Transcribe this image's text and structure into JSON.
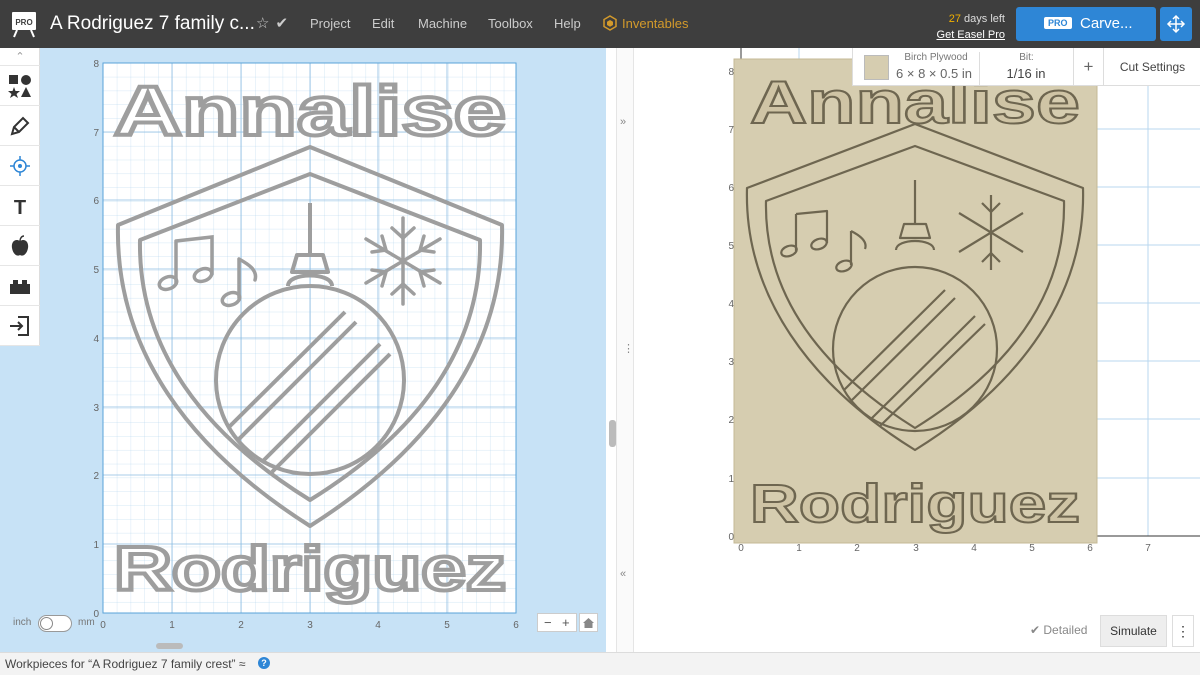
{
  "app": {
    "logo_text": "PRO",
    "doc_title": "A Rodriguez 7 family c...",
    "menu": [
      "Project",
      "Edit",
      "Machine",
      "Toolbox",
      "Help"
    ],
    "inventables_label": "Inventables",
    "trial_days": "27",
    "trial_suffix": " days left",
    "upgrade_label": "Get Easel Pro",
    "pro_badge": "PRO",
    "carve_label": "Carve...",
    "icons": {
      "favorite": "star-icon",
      "saved": "check-icon",
      "expand": "expand-arrows-icon"
    }
  },
  "toolbar": {
    "tools": [
      "shapes-icon",
      "pen-icon",
      "target-icon",
      "text-icon",
      "apple-icon",
      "lego-icon",
      "import-icon"
    ],
    "text_tool_glyph": "T"
  },
  "design": {
    "title_top": "Annalise",
    "title_bottom": "Rodriguez",
    "x_ticks": [
      "0",
      "1",
      "2",
      "3",
      "4",
      "5",
      "6"
    ],
    "y_ticks": [
      "0",
      "1",
      "2",
      "3",
      "4",
      "5",
      "6",
      "7",
      "8"
    ],
    "unit_left": "inch",
    "unit_right": "mm",
    "zoom_minus": "−",
    "zoom_plus": "+"
  },
  "divider": {
    "collapse_right": "»",
    "collapse_left": "«",
    "grip": "⋮"
  },
  "stock": {
    "material_name": "Birch Plywood",
    "material_dims": "6 × 8 × 0.5 in",
    "bit_label": "Bit:",
    "bit_value": "1/16 in",
    "add_label": "+",
    "cut_settings_label": "Cut Settings",
    "material_color": "#d6cdb0"
  },
  "preview": {
    "x_ticks": [
      "0",
      "1",
      "2",
      "3",
      "4",
      "5",
      "6",
      "7"
    ],
    "y_ticks": [
      "0",
      "1",
      "2",
      "3",
      "4",
      "5",
      "6",
      "7",
      "8"
    ],
    "detailed_label": "✔ Detailed",
    "simulate_label": "Simulate",
    "more_label": "⋮"
  },
  "footer": {
    "workpieces_label": "Workpieces for “A Rodriguez 7 family crest” ≈",
    "help_glyph": "?"
  }
}
